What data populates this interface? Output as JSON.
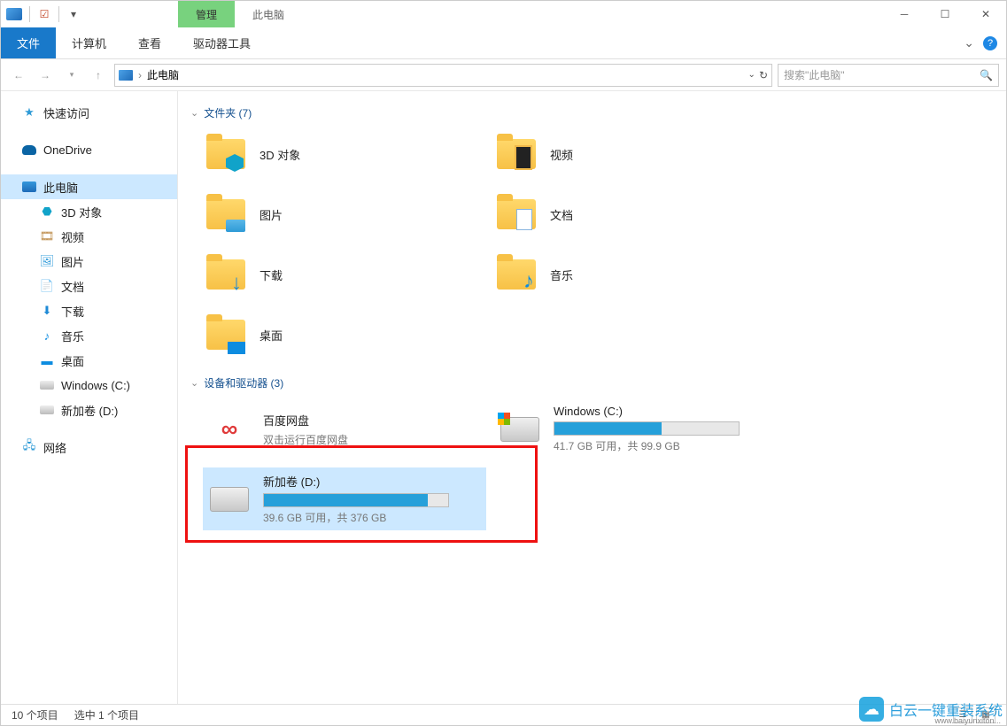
{
  "titlebar": {
    "manage_tab": "管理",
    "title": "此电脑"
  },
  "ribbon": {
    "file": "文件",
    "computer": "计算机",
    "view": "查看",
    "drive_tools": "驱动器工具"
  },
  "addressbar": {
    "location": "此电脑"
  },
  "search": {
    "placeholder": "搜索\"此电脑\""
  },
  "sidebar": {
    "quick_access": "快速访问",
    "onedrive": "OneDrive",
    "this_pc": "此电脑",
    "items": [
      "3D 对象",
      "视频",
      "图片",
      "文档",
      "下载",
      "音乐",
      "桌面",
      "Windows (C:)",
      "新加卷 (D:)"
    ],
    "network": "网络"
  },
  "groups": {
    "folders_header": "文件夹 (7)",
    "drives_header": "设备和驱动器 (3)"
  },
  "folders": [
    {
      "name": "3D 对象"
    },
    {
      "name": "视频"
    },
    {
      "name": "图片"
    },
    {
      "name": "文档"
    },
    {
      "name": "下载"
    },
    {
      "name": "音乐"
    },
    {
      "name": "桌面"
    }
  ],
  "drives": {
    "baidu": {
      "name": "百度网盘",
      "sub": "双击运行百度网盘"
    },
    "c": {
      "name": "Windows (C:)",
      "status": "41.7 GB 可用，共 99.9 GB",
      "fill_pct": 58
    },
    "d": {
      "name": "新加卷 (D:)",
      "status": "39.6 GB 可用，共 376 GB",
      "fill_pct": 89
    }
  },
  "statusbar": {
    "count": "10 个项目",
    "selected": "选中 1 个项目"
  },
  "watermark": {
    "text": "白云一键重装系统",
    "url": "www.baiyunxiton..."
  }
}
